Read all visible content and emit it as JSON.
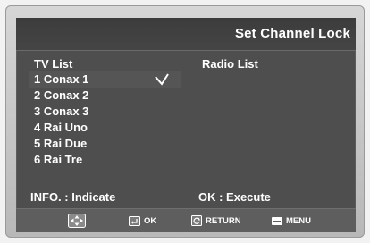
{
  "header": {
    "title": "Set Channel Lock"
  },
  "columns": {
    "tv_heading": "TV List",
    "radio_heading": "Radio List"
  },
  "tv_list": [
    {
      "label": "1 Conax 1",
      "locked": true
    },
    {
      "label": "2 Conax 2",
      "locked": false
    },
    {
      "label": "3 Conax 3",
      "locked": false
    },
    {
      "label": "4 Rai Uno",
      "locked": false
    },
    {
      "label": "5 Rai Due",
      "locked": false
    },
    {
      "label": "6 Rai Tre",
      "locked": false
    }
  ],
  "hints": {
    "info": "INFO. : Indicate",
    "ok": "OK : Execute"
  },
  "help_bar": {
    "nav_icon": "navigation-pad-icon",
    "ok_icon": "enter-icon",
    "ok_label": "OK",
    "return_icon": "return-icon",
    "return_label": "RETURN",
    "menu_icon": "menu-icon",
    "menu_label": "MENU"
  },
  "colors": {
    "screen_bg": "#4e4e4e",
    "text": "#ffffff"
  }
}
